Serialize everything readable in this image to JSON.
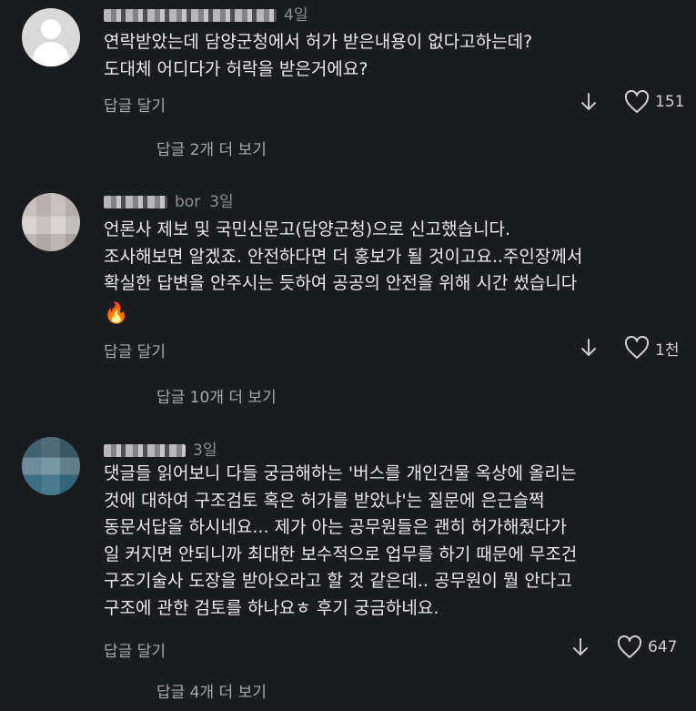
{
  "comments": [
    {
      "username": "naturaI",
      "time": "4일",
      "text": "연락받았는데 담양군청에서 허가 받은내용이 없다고하는데?\n도대체 어디다가 허락을 받은거에요?",
      "reply_label": "답글 달기",
      "likes": "151",
      "more_replies": "답글 2개 더 보기"
    },
    {
      "username": "bor",
      "time": "3일",
      "text": "언론사 제보 및 국민신문고(담양군청)으로 신고했습니다.\n조사해보면 알겠죠. 안전하다면 더 홍보가 될 것이고요..주인장께서\n확실한 답변을 안주시는 듯하여 공공의 안전을 위해 시간 썼습니다",
      "emoji": "🔥",
      "reply_label": "답글 달기",
      "likes": "1천",
      "more_replies": "답글 10개 더 보기"
    },
    {
      "username": "",
      "time": "3일",
      "text": "댓글들 읽어보니 다들 궁금해하는 '버스를 개인건물 옥상에 올리는\n것에 대하여 구조검토 혹은 허가를 받았냐'는 질문에 은근슬쩍\n동문서답을 하시네요... 제가 아는 공무원들은 괜히 허가해줬다가\n일 커지면 안되니까 최대한 보수적으로 업무를 하기 때문에 무조건\n구조기술사 도장을 받아오라고 할 것 같은데.. 공무원이 뭘 안다고\n구조에 관한 검토를 하나요ㅎ 후기 궁금하네요.",
      "reply_label": "답글 달기",
      "likes": "647",
      "more_replies": "답글 4개 더 보기"
    }
  ],
  "icons": {
    "down": "arrow-down-icon",
    "heart": "heart-icon"
  },
  "colors": {
    "background": "#1b1c1f",
    "text": "#eaeaeb",
    "muted": "#8e8f93"
  }
}
